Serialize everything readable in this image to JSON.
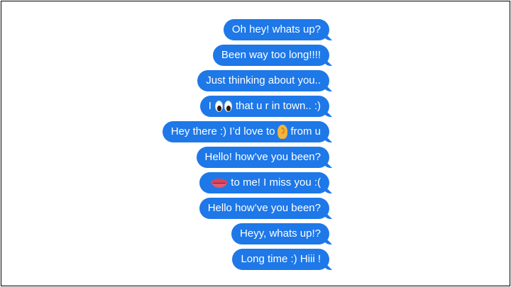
{
  "messages": [
    {
      "text": "Oh hey! whats up?"
    },
    {
      "text": "Been way too long!!!!"
    },
    {
      "text": "Just thinking about you.."
    },
    {
      "pre": "I",
      "icon": "eyes-emoji",
      "post": "that u r in town.. :)"
    },
    {
      "pre": "Hey there :) I’d love to",
      "icon": "ear-emoji",
      "post": "from u"
    },
    {
      "text": "Hello! how’ve you been?"
    },
    {
      "pre": "",
      "icon": "lips-emoji",
      "post": "to me! I miss you :("
    },
    {
      "text": "Hello how’ve you been?"
    },
    {
      "text": "Heyy, whats up!?"
    },
    {
      "text": "Long time :) Hiii !"
    }
  ],
  "colors": {
    "bubble": "#1E78E8",
    "bubble_text": "#FFFFFF",
    "background": "#FFFFFF"
  }
}
